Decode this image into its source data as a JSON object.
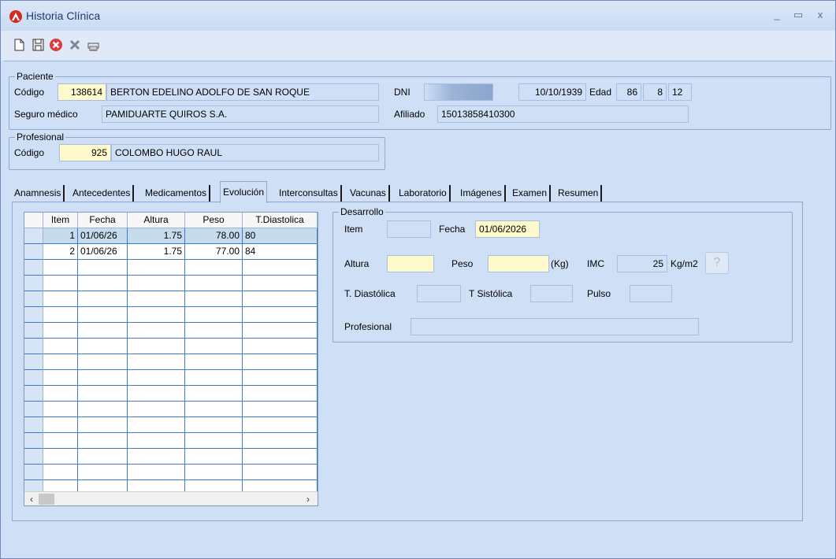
{
  "window": {
    "title": "Historia Clínica",
    "minimize_glyph": "_",
    "maximize_glyph": "▭",
    "close_glyph": "x"
  },
  "toolbar": {
    "icons": [
      "new-document-icon",
      "save-icon",
      "cancel-icon",
      "delete-icon",
      "print-icon"
    ]
  },
  "paciente": {
    "group_title": "Paciente",
    "codigo_label": "Código",
    "codigo": "138614",
    "nombre": "BERTON EDELINO ADOLFO DE SAN ROQUE",
    "dni_label": "DNI",
    "dni": "",
    "fecha_nacimiento": "10/10/1939",
    "edad_label": "Edad",
    "edad_anios": "86",
    "edad_meses": "8",
    "edad_dias": "12",
    "seguro_label": "Seguro médico",
    "seguro": "PAMIDUARTE QUIROS S.A.",
    "afiliado_label": "Afiliado",
    "afiliado": "15013858410300"
  },
  "profesional": {
    "group_title": "Profesional",
    "codigo_label": "Código",
    "codigo": "925",
    "nombre": "COLOMBO HUGO RAUL"
  },
  "tabs": [
    {
      "label": "Anamnesis"
    },
    {
      "label": "Antecedentes"
    },
    {
      "label": "Medicamentos"
    },
    {
      "label": "Evolución"
    },
    {
      "label": "Interconsultas"
    },
    {
      "label": "Vacunas"
    },
    {
      "label": "Laboratorio"
    },
    {
      "label": "Imágenes"
    },
    {
      "label": "Examen"
    },
    {
      "label": "Resumen"
    }
  ],
  "grid": {
    "columns": [
      "Item",
      "Fecha",
      "Altura",
      "Peso",
      "T.Diastolica"
    ],
    "rows": [
      [
        "1",
        "01/06/26",
        "1.75",
        "78.00",
        "80"
      ],
      [
        "2",
        "01/06/26",
        "1.75",
        "77.00",
        "84"
      ]
    ],
    "scroll_left": "‹",
    "scroll_right": "›"
  },
  "desarrollo": {
    "group_title": "Desarrollo",
    "item_label": "Item",
    "item": "",
    "fecha_label": "Fecha",
    "fecha": "01/06/2026",
    "altura_label": "Altura",
    "altura": "",
    "peso_label": "Peso",
    "peso": "",
    "kg_label": "(Kg)",
    "imc_label": "IMC",
    "imc": "25",
    "imc_unit": "Kg/m2",
    "help_glyph": "?",
    "tdiastolica_label": "T. Diastólica",
    "tdiastolica": "",
    "tsistolica_label": "T Sistólica",
    "tsistolica": "",
    "pulso_label": "Pulso",
    "pulso": "",
    "profesional_label": "Profesional",
    "profesional": ""
  },
  "colors": {
    "window_bg": "#cfdff5",
    "highlight_field": "#fffacb",
    "grid_line": "#3b7bd4",
    "selected_row": "#c5dced",
    "logo_red": "#d42a1f"
  }
}
